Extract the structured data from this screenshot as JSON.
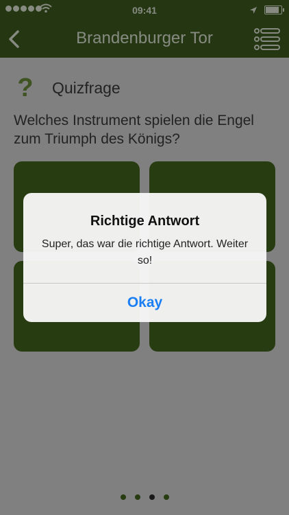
{
  "status_bar": {
    "time": "09:41",
    "signal_bars": 5,
    "battery_level": 0.95
  },
  "nav": {
    "title": "Brandenburger Tor",
    "back_icon": "chevron-left-icon",
    "menu_icon": "list-menu-icon"
  },
  "quiz": {
    "icon": "question-mark-icon",
    "label": "Quizfrage",
    "question": "Welches Instrument spielen die Engel zum Triumph des Königs?"
  },
  "pager": {
    "count": 4,
    "current_index": 2
  },
  "alert": {
    "title": "Richtige Antwort",
    "message": "Super, das war die richtige Antwort. Weiter so!",
    "button_label": "Okay"
  },
  "colors": {
    "nav_bar": "#3c5a1e",
    "answer_tile": "#43641f",
    "accent_icon": "#6b8a3a",
    "alert_button": "#1a7ef5",
    "pager_active": "#2a2a2a"
  }
}
